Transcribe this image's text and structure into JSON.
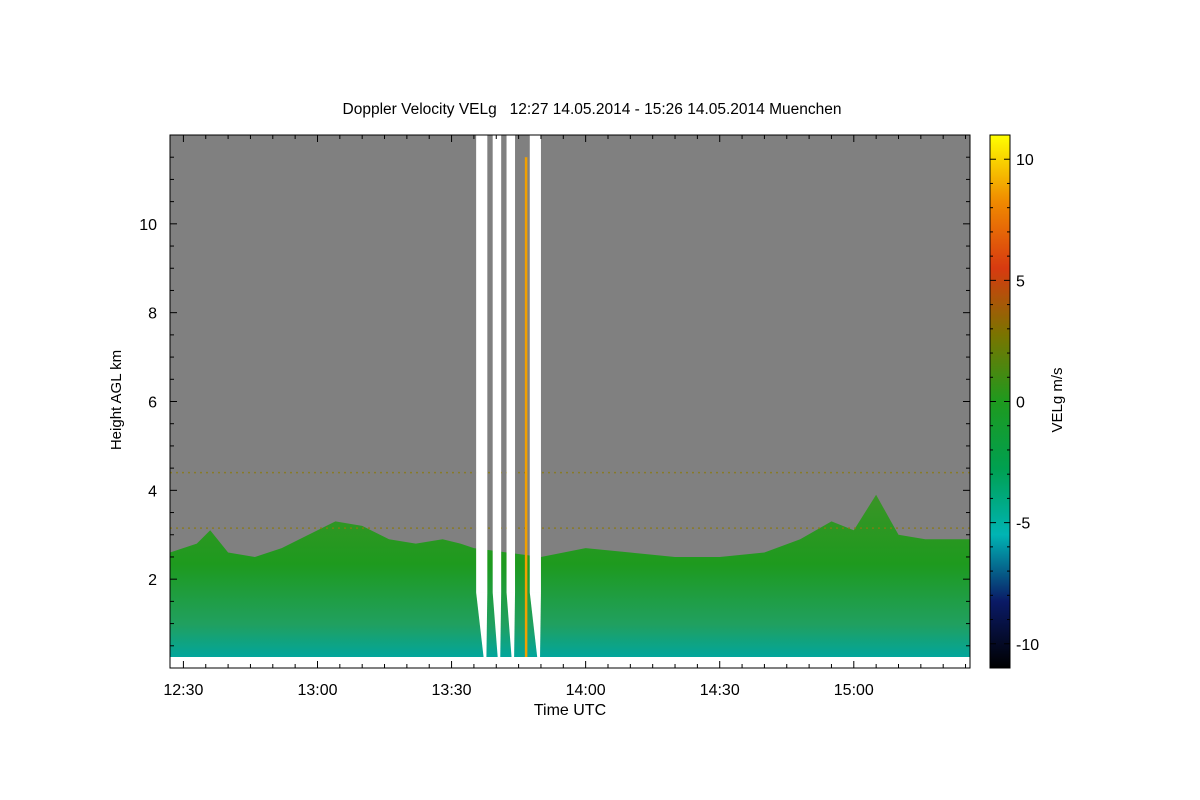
{
  "chart_data": {
    "type": "heatmap",
    "title": "Doppler Velocity VELg   12:27 14.05.2014 - 15:26 14.05.2014 Muenchen",
    "xlabel": "Time UTC",
    "ylabel": "Height AGL km",
    "x_range": [
      "12:27",
      "15:26"
    ],
    "xlim_minutes_utc": [
      747,
      926
    ],
    "ylim_km": [
      0,
      12
    ],
    "x_ticks": [
      {
        "minute": 750,
        "label": "12:30"
      },
      {
        "minute": 780,
        "label": "13:00"
      },
      {
        "minute": 810,
        "label": "13:30"
      },
      {
        "minute": 840,
        "label": "14:00"
      },
      {
        "minute": 870,
        "label": "14:30"
      },
      {
        "minute": 900,
        "label": "15:00"
      }
    ],
    "y_ticks": [
      {
        "value": 2,
        "label": "2"
      },
      {
        "value": 4,
        "label": "4"
      },
      {
        "value": 6,
        "label": "6"
      },
      {
        "value": 8,
        "label": "8"
      },
      {
        "value": 10,
        "label": "10"
      }
    ],
    "colorbar": {
      "label": "VELg m/s",
      "range": [
        -11,
        11
      ],
      "ticks": [
        {
          "value": 10,
          "label": "10"
        },
        {
          "value": 5,
          "label": "5"
        },
        {
          "value": 0,
          "label": "0"
        },
        {
          "value": -5,
          "label": "-5"
        },
        {
          "value": -10,
          "label": "-10"
        }
      ],
      "colors": [
        "#000000",
        "#0a1a66",
        "#00b4b4",
        "#00a050",
        "#1e9a1e",
        "#7a7400",
        "#d83a10",
        "#f08a00",
        "#ffff00"
      ]
    },
    "background_color": "#808080",
    "no_data_color": "#ffffff",
    "precip_gaps_minutes": [
      [
        815.5,
        818
      ],
      [
        819.2,
        821.1
      ],
      [
        822.3,
        824.2
      ],
      [
        827.5,
        830
      ]
    ],
    "boundary_layer_top_km": [
      [
        747,
        2.6
      ],
      [
        753,
        2.8
      ],
      [
        756,
        3.1
      ],
      [
        760,
        2.6
      ],
      [
        766,
        2.5
      ],
      [
        772,
        2.7
      ],
      [
        778,
        3.0
      ],
      [
        784,
        3.3
      ],
      [
        790,
        3.2
      ],
      [
        796,
        2.9
      ],
      [
        802,
        2.8
      ],
      [
        808,
        2.9
      ],
      [
        812,
        2.8
      ],
      [
        815,
        2.7
      ],
      [
        830,
        2.5
      ],
      [
        840,
        2.7
      ],
      [
        850,
        2.6
      ],
      [
        860,
        2.5
      ],
      [
        870,
        2.5
      ],
      [
        880,
        2.6
      ],
      [
        888,
        2.9
      ],
      [
        895,
        3.3
      ],
      [
        900,
        3.1
      ],
      [
        905,
        3.9
      ],
      [
        910,
        3.0
      ],
      [
        916,
        2.9
      ],
      [
        926,
        2.9
      ]
    ]
  }
}
